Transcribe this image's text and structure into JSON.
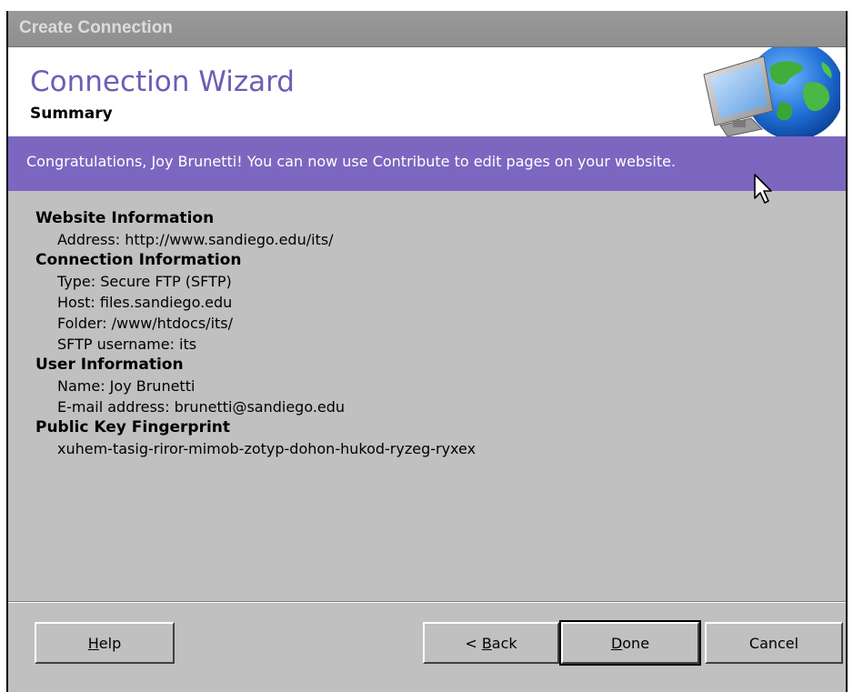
{
  "window": {
    "title": "Create Connection"
  },
  "header": {
    "title": "Connection Wizard",
    "subtitle": "Summary"
  },
  "banner": {
    "message": "Congratulations, Joy Brunetti! You can now use Contribute to edit pages on your website."
  },
  "summary": {
    "website": {
      "heading": "Website Information",
      "address": "Address: http://www.sandiego.edu/its/"
    },
    "connection": {
      "heading": "Connection Information",
      "type": "Type: Secure FTP (SFTP)",
      "host": "Host: files.sandiego.edu",
      "folder": "Folder: /www/htdocs/its/",
      "username": "SFTP username: its"
    },
    "user": {
      "heading": "User Information",
      "name": "Name: Joy Brunetti",
      "email": "E-mail address: brunetti@sandiego.edu"
    },
    "fingerprint": {
      "heading": "Public Key Fingerprint",
      "value": "xuhem-tasig-riror-mimob-zotyp-dohon-hukod-ryzeg-ryxex"
    }
  },
  "buttons": {
    "help": {
      "mnemonic": "H",
      "rest": "elp"
    },
    "back": {
      "prefix": "< ",
      "mnemonic": "B",
      "rest": "ack"
    },
    "done": {
      "mnemonic": "D",
      "rest": "one"
    },
    "cancel": {
      "label": "Cancel"
    }
  },
  "icons": {
    "header_art": "monitor-globe-icon",
    "pointer": "mouse-pointer-icon"
  },
  "colors": {
    "accent": "#7b67c0",
    "title_text": "#6e5cb8",
    "dialog_bg": "#c0c0c0"
  }
}
